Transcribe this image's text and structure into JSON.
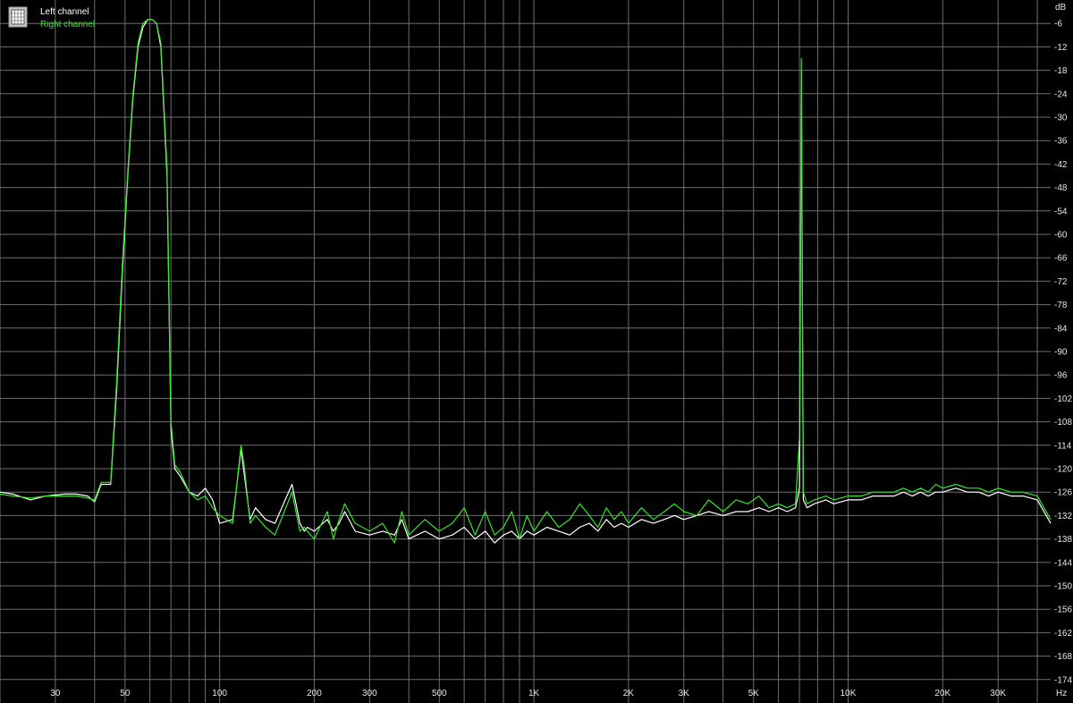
{
  "chart_data": {
    "type": "line",
    "title": "",
    "xlabel": "",
    "ylabel": "",
    "x_unit": "Hz",
    "y_unit": "dB",
    "x_scale": "log",
    "xlim": [
      20,
      44100
    ],
    "ylim": [
      -180,
      0
    ],
    "grid": true,
    "background": "#000000",
    "grid_color": "#6e6e6e",
    "legend_placement": "top-left",
    "x_ticks": [
      {
        "v": 30,
        "label": "30"
      },
      {
        "v": 50,
        "label": "50"
      },
      {
        "v": 100,
        "label": "100"
      },
      {
        "v": 200,
        "label": "200"
      },
      {
        "v": 300,
        "label": "300"
      },
      {
        "v": 500,
        "label": "500"
      },
      {
        "v": 1000,
        "label": "1K"
      },
      {
        "v": 2000,
        "label": "2K"
      },
      {
        "v": 3000,
        "label": "3K"
      },
      {
        "v": 5000,
        "label": "5K"
      },
      {
        "v": 10000,
        "label": "10K"
      },
      {
        "v": 20000,
        "label": "20K"
      },
      {
        "v": 30000,
        "label": "30K"
      }
    ],
    "x_minor_grid": [
      20,
      40,
      60,
      70,
      80,
      90,
      400,
      600,
      700,
      800,
      900,
      4000,
      6000,
      7000,
      8000,
      9000,
      40000
    ],
    "y_ticks": [
      -6,
      -12,
      -18,
      -24,
      -30,
      -36,
      -42,
      -48,
      -54,
      -60,
      -66,
      -72,
      -78,
      -84,
      -90,
      -96,
      -102,
      -108,
      -114,
      -120,
      -126,
      -132,
      -138,
      -144,
      -150,
      -156,
      -162,
      -168,
      -174
    ],
    "series": [
      {
        "name": "Left channel",
        "color": "#ffffff",
        "x": [
          20,
          22,
          25,
          28,
          32,
          35,
          38,
          40,
          42,
          45,
          47,
          49,
          51,
          53,
          55,
          57,
          59,
          61,
          63,
          65,
          68,
          70,
          72,
          75,
          80,
          85,
          90,
          95,
          100,
          110,
          117,
          120,
          125,
          130,
          140,
          150,
          170,
          180,
          186,
          190,
          200,
          220,
          230,
          240,
          250,
          270,
          300,
          330,
          360,
          380,
          400,
          450,
          500,
          550,
          600,
          650,
          700,
          750,
          800,
          850,
          900,
          950,
          1000,
          1100,
          1200,
          1300,
          1400,
          1500,
          1600,
          1700,
          1800,
          1900,
          2000,
          2200,
          2400,
          2600,
          2800,
          3000,
          3300,
          3600,
          4000,
          4400,
          4800,
          5200,
          5600,
          6000,
          6400,
          6800,
          7000,
          7100,
          7200,
          7400,
          7800,
          8500,
          9000,
          10000,
          11000,
          12000,
          13000,
          14000,
          15000,
          16000,
          17000,
          18000,
          19000,
          20000,
          22000,
          24000,
          26000,
          28000,
          30000,
          33000,
          36000,
          40000,
          44100
        ],
        "y": [
          -126,
          -126.5,
          -128,
          -127,
          -126.5,
          -126.5,
          -127,
          -128.5,
          -124,
          -124,
          -100,
          -70,
          -45,
          -25,
          -12,
          -7,
          -5,
          -5,
          -6,
          -12,
          -45,
          -110,
          -120,
          -122,
          -126,
          -127,
          -125,
          -128,
          -134,
          -133,
          -115,
          -122,
          -133,
          -130,
          -133,
          -134,
          -124,
          -134,
          -136,
          -135,
          -136,
          -133,
          -136,
          -134,
          -131,
          -136,
          -137,
          -136,
          -137,
          -133,
          -138,
          -136,
          -138,
          -137,
          -135,
          -138,
          -136,
          -139,
          -137,
          -136,
          -138,
          -136,
          -137,
          -135,
          -136,
          -137,
          -135,
          -134,
          -136,
          -133,
          -135,
          -134,
          -135,
          -133,
          -134,
          -133,
          -132,
          -133,
          -132,
          -131,
          -132,
          -131,
          -131,
          -130,
          -131,
          -130,
          -131,
          -130,
          -125,
          -18,
          -128,
          -130,
          -129,
          -128,
          -129,
          -128,
          -128,
          -127,
          -127,
          -127,
          -126,
          -127,
          -126,
          -127,
          -126,
          -126,
          -125,
          -126,
          -126,
          -127,
          -126,
          -127,
          -127,
          -128,
          -134
        ]
      },
      {
        "name": "Right channel",
        "color": "#33e62a",
        "x": [
          20,
          22,
          25,
          28,
          32,
          35,
          38,
          40,
          42,
          45,
          47,
          49,
          51,
          53,
          55,
          57,
          59,
          61,
          63,
          65,
          68,
          70,
          72,
          75,
          80,
          85,
          90,
          95,
          100,
          110,
          117,
          120,
          125,
          130,
          140,
          150,
          170,
          180,
          186,
          190,
          200,
          220,
          230,
          240,
          250,
          270,
          300,
          330,
          360,
          380,
          400,
          450,
          500,
          550,
          600,
          650,
          700,
          750,
          800,
          850,
          900,
          950,
          1000,
          1100,
          1200,
          1300,
          1400,
          1500,
          1600,
          1700,
          1800,
          1900,
          2000,
          2200,
          2400,
          2600,
          2800,
          3000,
          3300,
          3600,
          4000,
          4400,
          4800,
          5200,
          5600,
          6000,
          6400,
          6800,
          7000,
          7100,
          7200,
          7400,
          7800,
          8500,
          9000,
          10000,
          11000,
          12000,
          13000,
          14000,
          15000,
          16000,
          17000,
          18000,
          19000,
          20000,
          22000,
          24000,
          26000,
          28000,
          30000,
          33000,
          36000,
          40000,
          44100
        ],
        "y": [
          -126.5,
          -127,
          -127.5,
          -127,
          -127,
          -127,
          -127.5,
          -128,
          -123.5,
          -123.5,
          -98,
          -68,
          -44,
          -24,
          -11,
          -6,
          -5,
          -5,
          -6,
          -11,
          -43,
          -108,
          -119,
          -121,
          -126,
          -128,
          -127,
          -130,
          -132,
          -134,
          -114,
          -120,
          -134,
          -132,
          -135,
          -137,
          -126,
          -136,
          -135,
          -136,
          -138,
          -131,
          -138,
          -133,
          -129,
          -134,
          -136,
          -134,
          -139,
          -131,
          -137,
          -133,
          -136,
          -134,
          -130,
          -137,
          -131,
          -137,
          -135,
          -131,
          -138,
          -132,
          -136,
          -131,
          -135,
          -133,
          -129,
          -132,
          -135,
          -130,
          -133,
          -131,
          -134,
          -130,
          -133,
          -131,
          -129,
          -131,
          -132,
          -128,
          -131,
          -128,
          -129,
          -127,
          -130,
          -129,
          -130,
          -129,
          -112,
          -15,
          -126,
          -129,
          -128,
          -127,
          -128,
          -127,
          -127,
          -126,
          -126,
          -126,
          -125,
          -126,
          -125,
          -126,
          -124,
          -125,
          -124,
          -125,
          -125,
          -126,
          -125,
          -126,
          -126,
          -127,
          -133
        ]
      }
    ]
  },
  "legend": {
    "left_label": "Left channel",
    "right_label": "Right channel"
  }
}
